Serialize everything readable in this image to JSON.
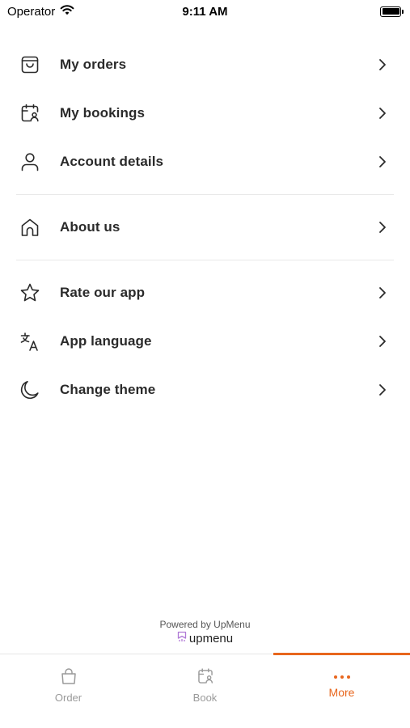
{
  "status_bar": {
    "carrier": "Operator",
    "time": "9:11 AM"
  },
  "menu": {
    "group1": [
      {
        "label": "My orders",
        "icon": "shopping-bag-icon"
      },
      {
        "label": "My bookings",
        "icon": "calendar-user-icon"
      },
      {
        "label": "Account details",
        "icon": "user-icon"
      }
    ],
    "group2": [
      {
        "label": "About us",
        "icon": "home-icon"
      }
    ],
    "group3": [
      {
        "label": "Rate our app",
        "icon": "star-icon"
      },
      {
        "label": "App language",
        "icon": "translate-icon"
      },
      {
        "label": "Change theme",
        "icon": "moon-icon"
      }
    ]
  },
  "footer": {
    "powered_by": "Powered by UpMenu",
    "brand": "upmenu"
  },
  "tab_bar": {
    "tabs": [
      {
        "label": "Order",
        "icon": "shopping-bag-icon",
        "active": false
      },
      {
        "label": "Book",
        "icon": "calendar-user-icon",
        "active": false
      },
      {
        "label": "More",
        "icon": "more-dots-icon",
        "active": true
      }
    ]
  },
  "colors": {
    "accent": "#e8661d",
    "text": "#2a2a2a",
    "inactive": "#9a9a9a",
    "brand_icon": "#b07ad6"
  }
}
